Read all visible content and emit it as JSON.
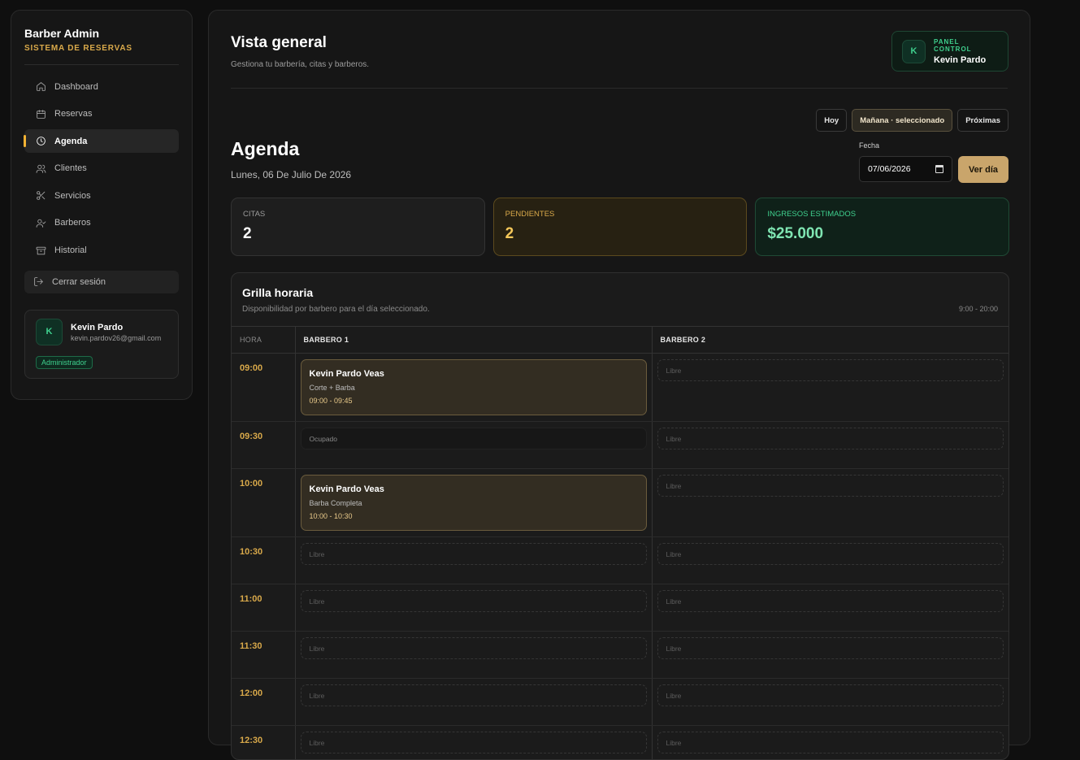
{
  "sidebar": {
    "brand_title": "Barber Admin",
    "brand_subtitle": "SISTEMA DE RESERVAS",
    "items": [
      {
        "label": "Dashboard",
        "icon": "home-icon"
      },
      {
        "label": "Reservas",
        "icon": "calendar-icon"
      },
      {
        "label": "Agenda",
        "icon": "clock-icon",
        "active": true
      },
      {
        "label": "Clientes",
        "icon": "users-icon"
      },
      {
        "label": "Servicios",
        "icon": "scissors-icon"
      },
      {
        "label": "Barberos",
        "icon": "user-check-icon"
      },
      {
        "label": "Historial",
        "icon": "archive-icon"
      }
    ],
    "logout_label": "Cerrar sesión",
    "user": {
      "initial": "K",
      "name": "Kevin Pardo",
      "email": "kevin.pardov26@gmail.com",
      "role": "Administrador"
    }
  },
  "header": {
    "title": "Vista general",
    "subtitle": "Gestiona tu barbería, citas y barberos.",
    "panel_label": "PANEL CONTROL",
    "panel_name": "Kevin Pardo",
    "panel_initial": "K"
  },
  "filters": {
    "today": "Hoy",
    "tomorrow": "Mañana · seleccionado",
    "upcoming": "Próximas"
  },
  "agenda": {
    "title": "Agenda",
    "date_text": "Lunes, 06 De Julio De 2026",
    "date_label": "Fecha",
    "date_value": "07/06/2026",
    "view_button": "Ver día"
  },
  "stats": {
    "citas_label": "CITAS",
    "citas_value": "2",
    "pendientes_label": "PENDIENTES",
    "pendientes_value": "2",
    "ingresos_label": "INGRESOS ESTIMADOS",
    "ingresos_value": "$25.000"
  },
  "grid": {
    "title": "Grilla horaria",
    "subtitle": "Disponibilidad por barbero para el día seleccionado.",
    "range": "9:00 - 20:00",
    "col_hora": "HORA",
    "col_b1": "BARBERO 1",
    "col_b2": "BARBERO 2",
    "rows": [
      {
        "time": "09:00",
        "b1": {
          "type": "appt",
          "client": "Kevin Pardo Veas",
          "service": "Corte + Barba",
          "range": "09:00 - 09:45"
        },
        "b2": {
          "type": "free",
          "label": "Libre"
        }
      },
      {
        "time": "09:30",
        "b1": {
          "type": "busy",
          "label": "Ocupado"
        },
        "b2": {
          "type": "free",
          "label": "Libre"
        }
      },
      {
        "time": "10:00",
        "b1": {
          "type": "appt",
          "client": "Kevin Pardo Veas",
          "service": "Barba Completa",
          "range": "10:00 - 10:30"
        },
        "b2": {
          "type": "free",
          "label": "Libre"
        }
      },
      {
        "time": "10:30",
        "b1": {
          "type": "free",
          "label": "Libre"
        },
        "b2": {
          "type": "free",
          "label": "Libre"
        }
      },
      {
        "time": "11:00",
        "b1": {
          "type": "free",
          "label": "Libre"
        },
        "b2": {
          "type": "free",
          "label": "Libre"
        }
      },
      {
        "time": "11:30",
        "b1": {
          "type": "free",
          "label": "Libre"
        },
        "b2": {
          "type": "free",
          "label": "Libre"
        }
      },
      {
        "time": "12:00",
        "b1": {
          "type": "free",
          "label": "Libre"
        },
        "b2": {
          "type": "free",
          "label": "Libre"
        }
      },
      {
        "time": "12:30",
        "b1": {
          "type": "free",
          "label": "Libre"
        },
        "b2": {
          "type": "free",
          "label": "Libre"
        }
      }
    ]
  }
}
